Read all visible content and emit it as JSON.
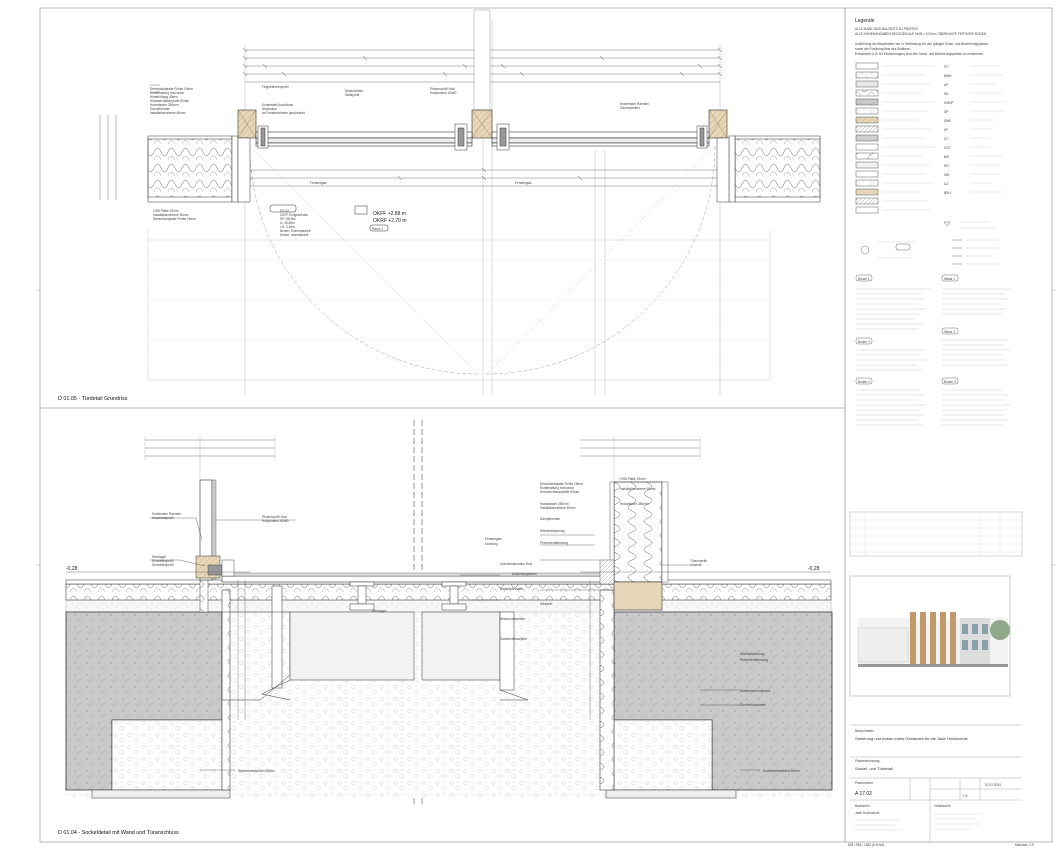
{
  "sheet": {
    "upper_detail_caption": "D 01.05 - Türdetail Grundriss",
    "lower_detail_caption": "D 01.04 - Sockeldetail mit Wand und Türanschluss",
    "footer_center": "528 / 981 / 1382 (6.0Hx0)",
    "footer_right": "Maßstab: 1:5"
  },
  "legend": {
    "title": "Legende",
    "line1": "ALLE MAßE SIND BAUSEITS ZU PRÜFEN!",
    "line2": "ALLE HÖHENANGABEN BEZOGEN AUF NHN = 0,00m= OBERKANTE FERTIGER BODEN",
    "tags": [
      "Decke 1",
      "Boden 1",
      "Wand 1",
      "Wand 3",
      "Boden 2",
      "Boden 3"
    ],
    "right_codes": [
      "ST",
      "BWH",
      "UP",
      "SN",
      "SWHP",
      "DP",
      "DWF",
      "KF",
      "UT",
      "GST",
      "BIS",
      "RO",
      "WD",
      "UZ",
      "BSH"
    ]
  },
  "upper_plan": {
    "elevation_1": "OKFF +2.88 m",
    "elevation_2": "OKRF +2.70 m",
    "room_tag": "Raum 1"
  },
  "lower_section": {
    "level_left": "-0,28",
    "level_right": "-0,28",
    "annotations": [
      "Abdichtungsbahn",
      "Schwellenprofil",
      "Stelzlager",
      "Wärmedämmung",
      "Perimeterdämmung",
      "Sauberkeitsschicht 50mm"
    ]
  },
  "titleblock": {
    "project_label": "Bauvorhaben",
    "project_name": "Sanierung und Anbau eines Gebäudes für die Jade Hochschule",
    "plan_label": "Planbezeichnung",
    "plan_name": "Sockel- und Türdetail",
    "plan_number_label": "Plannummer",
    "plan_number": "A 17.02",
    "owner_label": "Bauherr/in",
    "owner_name": "Jade Hochschule",
    "author_label": "Verfasser/in",
    "date_value": "07.02.2024",
    "scale_value": "1:5"
  }
}
